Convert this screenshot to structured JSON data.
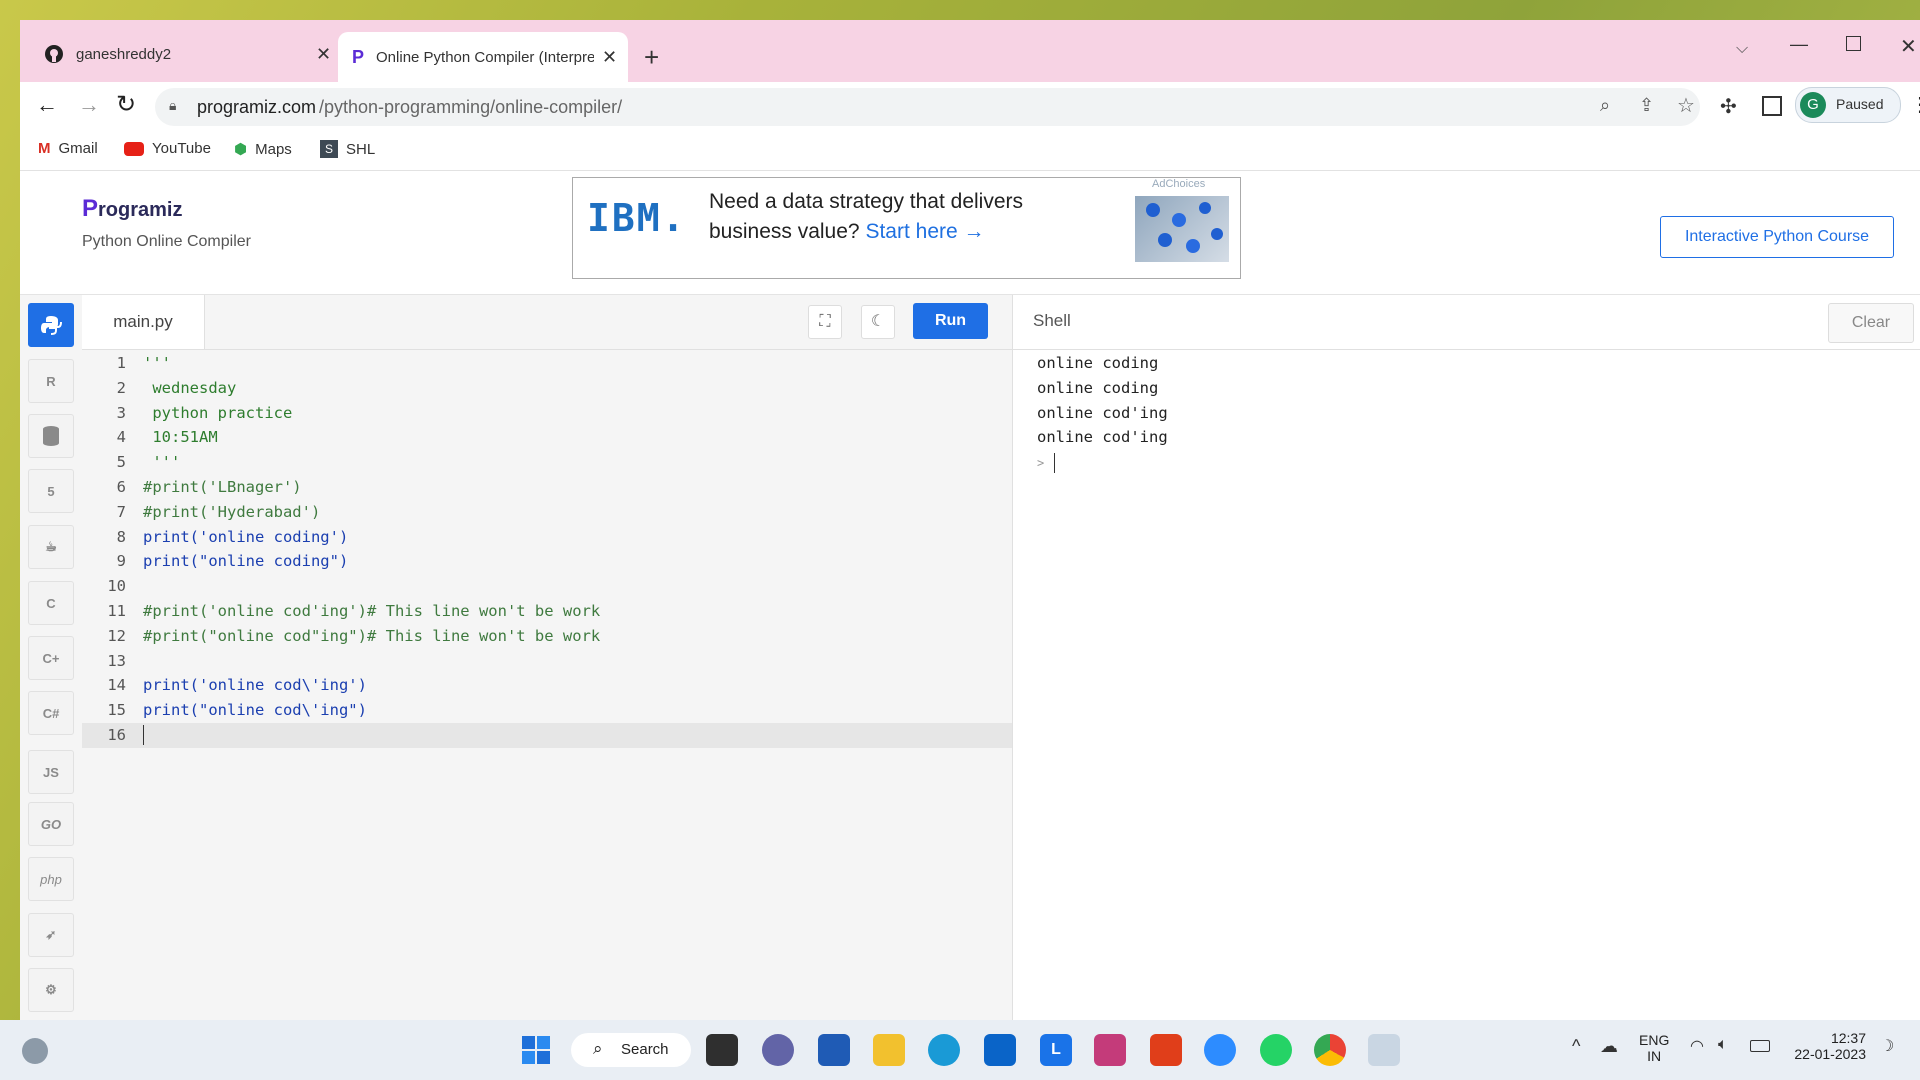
{
  "browser": {
    "tabs": [
      {
        "title": "ganeshreddy2"
      },
      {
        "title": "Online Python Compiler (Interpre"
      }
    ],
    "new_tab_symbol": "+",
    "url_domain": "programiz.com",
    "url_path": "/python-programming/online-compiler/",
    "profile_initial": "G",
    "profile_status": "Paused"
  },
  "bookmarks": [
    {
      "label": "Gmail"
    },
    {
      "label": "YouTube"
    },
    {
      "label": "Maps"
    },
    {
      "label": "SHL"
    }
  ],
  "site": {
    "logo_text": "rogramiz",
    "logo_p": "P",
    "subtitle": "Python Online Compiler",
    "course_button": "Interactive Python Course"
  },
  "ad": {
    "brand": "IBM.",
    "headline": "Need a data strategy that delivers",
    "headline2": "business value?",
    "cta": "Start here",
    "adchoices": "AdChoices"
  },
  "sidebar_langs": [
    "python",
    "R",
    "SQL",
    "HTML",
    "Java",
    "C",
    "C++",
    "C#",
    "JS",
    "GO",
    "php",
    "Swift",
    "Rust"
  ],
  "sidebar_labels": {
    "js": "JS",
    "go": "GO",
    "php": "php"
  },
  "editor": {
    "filename": "main.py",
    "run_label": "Run",
    "lines": [
      {
        "n": "1",
        "text": "'''"
      },
      {
        "n": "2",
        "text": " wednesday"
      },
      {
        "n": "3",
        "text": " python practice"
      },
      {
        "n": "4",
        "text": " 10:51AM"
      },
      {
        "n": "5",
        "text": " '''"
      },
      {
        "n": "6",
        "text": "#print('LBnager')"
      },
      {
        "n": "7",
        "text": "#print('Hyderabad')"
      },
      {
        "n": "8",
        "text": "print('online coding')"
      },
      {
        "n": "9",
        "text": "print(\"online coding\")"
      },
      {
        "n": "10",
        "text": ""
      },
      {
        "n": "11",
        "text": "#print('online cod'ing')# This line won't be work"
      },
      {
        "n": "12",
        "text": "#print(\"online cod\"ing\")# This line won't be work"
      },
      {
        "n": "13",
        "text": ""
      },
      {
        "n": "14",
        "text": "print('online cod\\'ing')"
      },
      {
        "n": "15",
        "text": "print(\"online cod\\'ing\")"
      },
      {
        "n": "16",
        "text": ""
      }
    ]
  },
  "shell": {
    "title": "Shell",
    "clear_label": "Clear",
    "output": [
      "online coding",
      "online coding",
      "online cod'ing",
      "online cod'ing"
    ],
    "prompt": ">"
  },
  "taskbar": {
    "search_label": "Search",
    "lang_top": "ENG",
    "lang_bottom": "IN",
    "time": "12:37",
    "date": "22-01-2023"
  },
  "colors": {
    "accent": "#1f6fe5",
    "tabstrip": "#f7d3e4",
    "programiz_purple": "#5b2bd6",
    "comment_green": "#3f7a3f"
  }
}
